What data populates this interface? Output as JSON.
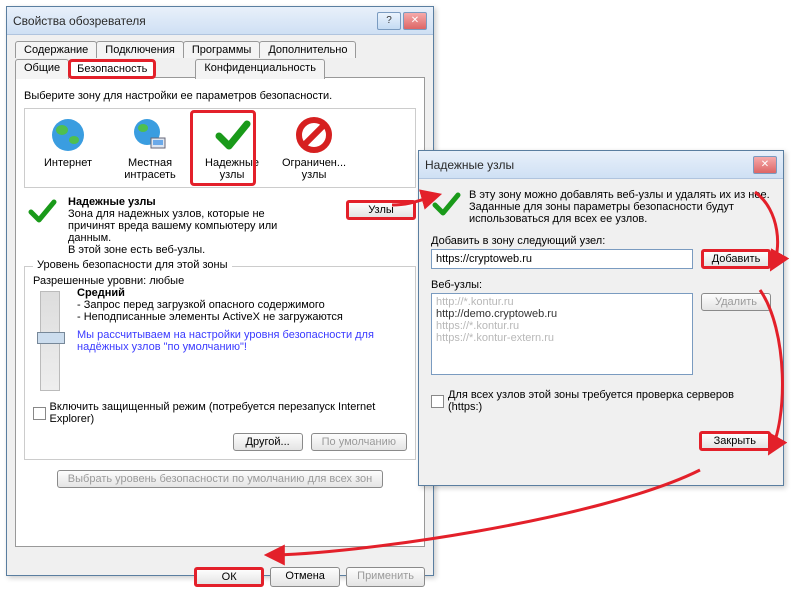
{
  "props_window": {
    "title": "Свойства обозревателя",
    "help_glyph": "?",
    "close_glyph": "✕",
    "tabs_row1": [
      "Содержание",
      "Подключения",
      "Программы",
      "Дополнительно"
    ],
    "tabs_row2": [
      "Общие",
      "Безопасность",
      "Конфиденциальность"
    ],
    "active_tab_index": 1,
    "zone_prompt": "Выберите зону для настройки ее параметров безопасности.",
    "zones": [
      {
        "name": "Интернет",
        "icon": "globe"
      },
      {
        "name": "Местная интрасеть",
        "icon": "globe-lan"
      },
      {
        "name": "Надежные узлы",
        "icon": "check"
      },
      {
        "name": "Ограничен... узлы",
        "icon": "forbidden"
      }
    ],
    "zone_title": "Надежные узлы",
    "zone_desc_lines": [
      "Зона для надежных узлов, которые не",
      "причинят вреда вашему компьютеру или",
      "данным.",
      "В этой зоне есть веб-узлы."
    ],
    "sites_btn": "Узлы",
    "sec_legend": "Уровень безопасности для этой зоны",
    "levels_allowed": "Разрешенные уровни: любые",
    "level_name": "Средний",
    "level_lines": [
      "- Запрос перед загрузкой опасного содержимого",
      "- Неподписанные элементы ActiveX не загружаются"
    ],
    "level_note": "Мы рассчитываем на настройки уровня безопасности для надёжных узлов \"по умолчанию\"!",
    "protected_mode": "Включить защищенный режим (потребуется перезапуск Internet Explorer)",
    "btn_other": "Другой...",
    "btn_default": "По умолчанию",
    "btn_reset": "Выбрать уровень безопасности по умолчанию для всех зон",
    "btn_ok": "ОК",
    "btn_cancel": "Отмена",
    "btn_apply": "Применить"
  },
  "trusted_window": {
    "title": "Надежные узлы",
    "close_glyph": "✕",
    "intro": "В эту зону можно добавлять веб-узлы и удалять их из нее. Заданные для зоны параметры безопасности будут использоваться для всех ее узлов.",
    "add_label": "Добавить в зону следующий узел:",
    "add_value": "https://cryptoweb.ru",
    "btn_add": "Добавить",
    "list_label": "Веб-узлы:",
    "sites": [
      {
        "t": "http://*.kontur.ru",
        "fade": true
      },
      {
        "t": "http://demo.cryptoweb.ru",
        "fade": false
      },
      {
        "t": "https://*.kontur.ru",
        "fade": true
      },
      {
        "t": "https://*.kontur-extern.ru",
        "fade": true
      }
    ],
    "btn_remove": "Удалить",
    "require_https": "Для всех узлов этой зоны требуется проверка серверов (https:)",
    "btn_close": "Закрыть"
  },
  "highlight_color": "#e3202a"
}
